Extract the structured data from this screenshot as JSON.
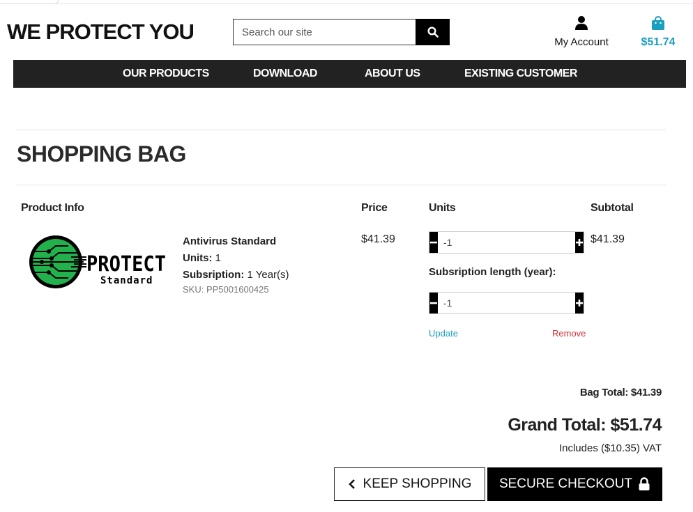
{
  "header": {
    "logo": "WE PROTECT YOU",
    "search_placeholder": "Search our site",
    "account_label": "My Account",
    "cart_total": "$51.74"
  },
  "nav": {
    "items": [
      "OUR PRODUCTS",
      "DOWNLOAD",
      "ABOUT US",
      "EXISTING CUSTOMER"
    ]
  },
  "page_title": "SHOPPING BAG",
  "columns": {
    "product_info": "Product Info",
    "price": "Price",
    "units": "Units",
    "subtotal": "Subtotal"
  },
  "product": {
    "logo_word": "PROTECT",
    "logo_sub": "Standard",
    "name": "Antivirus Standard",
    "units_label": "Units:",
    "units_value": "1",
    "subscription_label": "Subsription:",
    "subscription_value": "1 Year(s)",
    "sku": "SKU: PP5001600425",
    "price": "$41.39",
    "subtotal": "$41.39",
    "units_input": "-1",
    "sub_length_label": "Subsription length (year):",
    "sub_length_input": "-1",
    "update_label": "Update",
    "remove_label": "Remove"
  },
  "totals": {
    "bag_total": "Bag Total: $41.39",
    "grand_total": "Grand Total: $51.74",
    "vat": "Includes ($10.35) VAT"
  },
  "actions": {
    "keep_shopping": "KEEP SHOPPING",
    "secure_checkout": "SECURE CHECKOUT"
  },
  "colors": {
    "accent": "#1a9fbf",
    "remove": "#d63333",
    "nav_bg": "#222222",
    "logo_green": "#22b14c"
  }
}
